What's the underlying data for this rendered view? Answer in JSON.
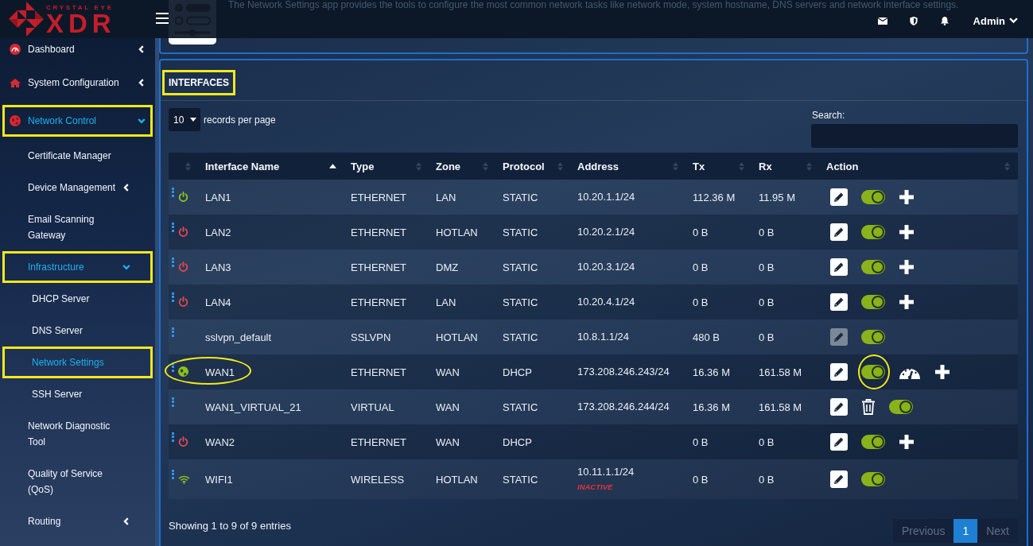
{
  "topbar": {
    "logo": {
      "tagline": "CRYSTAL EYE",
      "wordmark": "XDR"
    },
    "description": "The Network Settings app provides the tools to configure the most common network tasks like network mode, system hostname, DNS servers and network interface settings.",
    "user": "Admin"
  },
  "sidebar": {
    "items": [
      {
        "label": "Dashboard",
        "selected": false,
        "highlighted": false,
        "expanded": false
      },
      {
        "label": "System Configuration",
        "selected": false,
        "highlighted": false,
        "expanded": false
      },
      {
        "label": "Network Control",
        "selected": true,
        "highlighted": true,
        "expanded": true,
        "children": [
          {
            "label": "Certificate Manager",
            "selected": false,
            "highlighted": false
          },
          {
            "label": "Device Management",
            "selected": false,
            "highlighted": false,
            "expanded": false
          },
          {
            "label": "Email Scanning Gateway",
            "selected": false,
            "highlighted": false
          },
          {
            "label": "Infrastructure",
            "selected": true,
            "highlighted": true,
            "expanded": true,
            "children": [
              {
                "label": "DHCP Server",
                "selected": false,
                "highlighted": false
              },
              {
                "label": "DNS Server",
                "selected": false,
                "highlighted": false
              },
              {
                "label": "Network Settings",
                "selected": true,
                "highlighted": true
              },
              {
                "label": "SSH Server",
                "selected": false,
                "highlighted": false
              }
            ]
          },
          {
            "label": "Network Diagnostic Tool",
            "selected": false,
            "highlighted": false
          },
          {
            "label": "Quality of Service (QoS)",
            "selected": false,
            "highlighted": false
          },
          {
            "label": "Routing",
            "selected": false,
            "highlighted": false,
            "expanded": false
          }
        ]
      }
    ]
  },
  "panel": {
    "title": "INTERFACES",
    "title_highlighted": true,
    "page_size": "10",
    "page_size_label": "records per page",
    "search_label": "Search:"
  },
  "table": {
    "columns": [
      {
        "sorted": false
      },
      {
        "label": "Interface Name",
        "sorted": true
      },
      {
        "label": "Type",
        "sorted": false
      },
      {
        "label": "Zone",
        "sorted": false
      },
      {
        "label": "Protocol",
        "sorted": false
      },
      {
        "label": "Address",
        "sorted": false
      },
      {
        "label": "Tx",
        "sorted": false
      },
      {
        "label": "Rx",
        "sorted": false
      },
      {
        "label": "Action",
        "sorted": false
      }
    ],
    "rows": [
      {
        "link": {
          "kind": "power",
          "up": true
        },
        "name": "LAN1",
        "type": "ETHERNET",
        "zone": "LAN",
        "protocol": "STATIC",
        "address": "10.20.1.1/24",
        "tx": "112.36 M",
        "rx": "11.95 M",
        "highlighted": false,
        "actions": [
          {
            "kind": "edit",
            "disabled": false
          },
          {
            "kind": "toggle",
            "on": true,
            "highlighted": false
          },
          {
            "kind": "plus"
          }
        ]
      },
      {
        "link": {
          "kind": "power",
          "up": false
        },
        "name": "LAN2",
        "type": "ETHERNET",
        "zone": "HOTLAN",
        "protocol": "STATIC",
        "address": "10.20.2.1/24",
        "tx": "0 B",
        "rx": "0 B",
        "highlighted": false,
        "actions": [
          {
            "kind": "edit",
            "disabled": false
          },
          {
            "kind": "toggle",
            "on": true,
            "highlighted": false
          },
          {
            "kind": "plus"
          }
        ]
      },
      {
        "link": {
          "kind": "power",
          "up": false
        },
        "name": "LAN3",
        "type": "ETHERNET",
        "zone": "DMZ",
        "protocol": "STATIC",
        "address": "10.20.3.1/24",
        "tx": "0 B",
        "rx": "0 B",
        "highlighted": false,
        "actions": [
          {
            "kind": "edit",
            "disabled": false
          },
          {
            "kind": "toggle",
            "on": true,
            "highlighted": false
          },
          {
            "kind": "plus"
          }
        ]
      },
      {
        "link": {
          "kind": "power",
          "up": false
        },
        "name": "LAN4",
        "type": "ETHERNET",
        "zone": "LAN",
        "protocol": "STATIC",
        "address": "10.20.4.1/24",
        "tx": "0 B",
        "rx": "0 B",
        "highlighted": false,
        "actions": [
          {
            "kind": "edit",
            "disabled": false
          },
          {
            "kind": "toggle",
            "on": true,
            "highlighted": false
          },
          {
            "kind": "plus"
          }
        ]
      },
      {
        "name": "sslvpn_default",
        "type": "SSLVPN",
        "zone": "HOTLAN",
        "protocol": "STATIC",
        "address": "10.8.1.1/24",
        "tx": "480 B",
        "rx": "0 B",
        "highlighted": false,
        "actions": [
          {
            "kind": "edit",
            "disabled": true
          },
          {
            "kind": "toggle",
            "on": true,
            "highlighted": false
          }
        ]
      },
      {
        "link": {
          "kind": "globe",
          "up": true
        },
        "name": "WAN1",
        "type": "ETHERNET",
        "zone": "WAN",
        "protocol": "DHCP",
        "address": "173.208.246.243/24",
        "tx": "16.36 M",
        "rx": "161.58 M",
        "highlighted": true,
        "actions": [
          {
            "kind": "edit",
            "disabled": false
          },
          {
            "kind": "toggle",
            "on": true,
            "highlighted": true
          },
          {
            "kind": "gauge"
          },
          {
            "kind": "plus"
          }
        ]
      },
      {
        "name": "WAN1_VIRTUAL_21",
        "type": "VIRTUAL",
        "zone": "WAN",
        "protocol": "STATIC",
        "address": "173.208.246.244/24",
        "tx": "16.36 M",
        "rx": "161.58 M",
        "highlighted": false,
        "actions": [
          {
            "kind": "edit",
            "disabled": false
          },
          {
            "kind": "delete"
          },
          {
            "kind": "toggle",
            "on": true,
            "highlighted": false
          }
        ]
      },
      {
        "link": {
          "kind": "power",
          "up": false
        },
        "name": "WAN2",
        "type": "ETHERNET",
        "zone": "WAN",
        "protocol": "DHCP",
        "tx": "0 B",
        "rx": "0 B",
        "highlighted": false,
        "actions": [
          {
            "kind": "edit",
            "disabled": false
          },
          {
            "kind": "toggle",
            "on": true,
            "highlighted": false
          },
          {
            "kind": "plus"
          }
        ]
      },
      {
        "link": {
          "kind": "wifi",
          "up": true
        },
        "name": "WIFI1",
        "type": "WIRELESS",
        "zone": "HOTLAN",
        "protocol": "STATIC",
        "address": "10.11.1.1/24",
        "address_note": "INACTIVE",
        "tx": "0 B",
        "rx": "0 B",
        "highlighted": false,
        "actions": [
          {
            "kind": "edit",
            "disabled": false
          },
          {
            "kind": "toggle",
            "on": true,
            "highlighted": false
          }
        ]
      }
    ]
  },
  "footer": {
    "summary": "Showing 1 to 9 of 9 entries",
    "pages": [
      {
        "label": "Previous",
        "selected": false,
        "disabled": true
      },
      {
        "label": "1",
        "selected": true,
        "disabled": false
      },
      {
        "label": "Next",
        "selected": false,
        "disabled": true
      }
    ]
  }
}
